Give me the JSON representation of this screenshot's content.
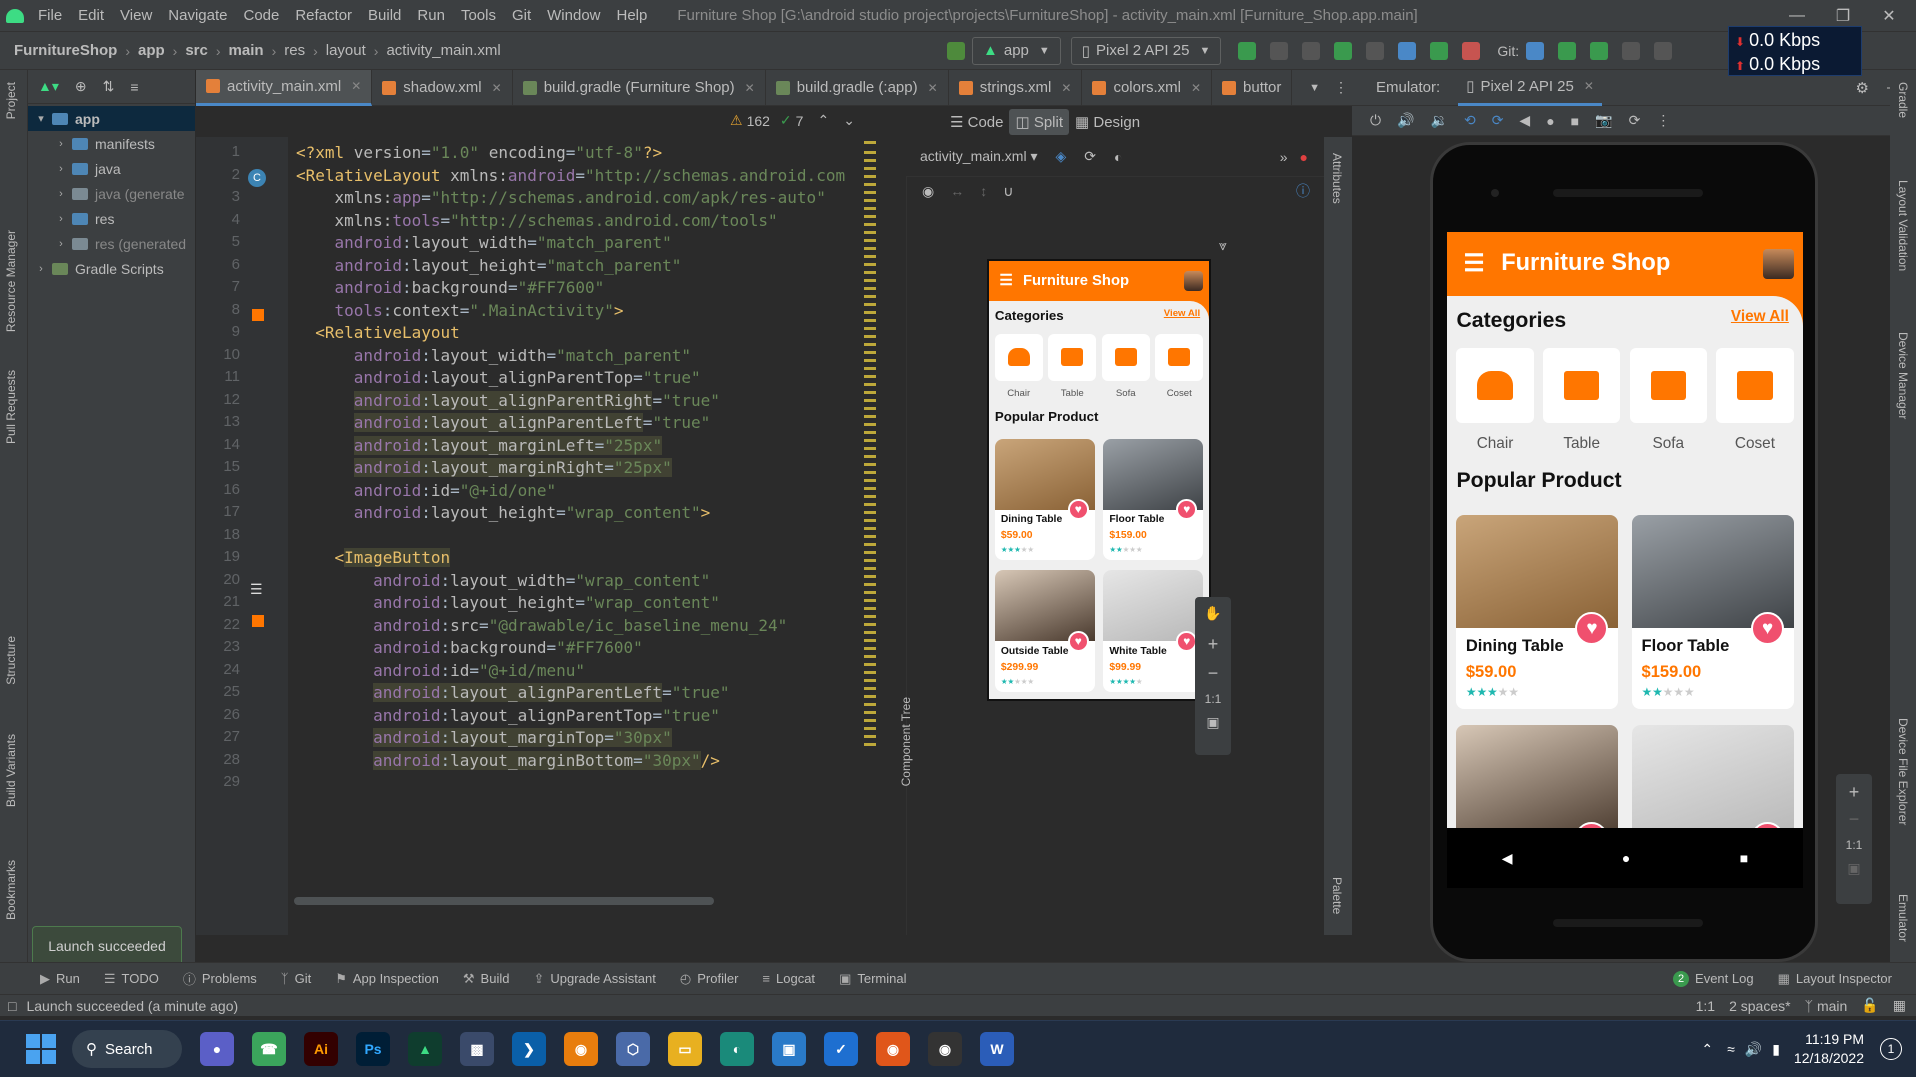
{
  "menubar": {
    "items": [
      "File",
      "Edit",
      "View",
      "Navigate",
      "Code",
      "Refactor",
      "Build",
      "Run",
      "Tools",
      "Git",
      "Window",
      "Help"
    ],
    "window_title": "Furniture Shop [G:\\android studio project\\projects\\FurnitureShop] - activity_main.xml [Furniture_Shop.app.main]"
  },
  "network": {
    "down": "0.0 Kbps",
    "up": "0.0 Kbps"
  },
  "breadcrumb": [
    "FurnitureShop",
    "app",
    "src",
    "main",
    "res",
    "layout",
    "activity_main.xml"
  ],
  "run_config": {
    "module": "app",
    "device": "Pixel 2 API 25",
    "git_label": "Git:"
  },
  "project_panel": {
    "tree": [
      {
        "label": "app",
        "level": 0,
        "expanded": true,
        "selected": true
      },
      {
        "label": "manifests",
        "level": 1
      },
      {
        "label": "java",
        "level": 1
      },
      {
        "label": "java (generate",
        "level": 1
      },
      {
        "label": "res",
        "level": 1
      },
      {
        "label": "res (generated",
        "level": 1
      },
      {
        "label": "Gradle Scripts",
        "level": 0
      }
    ]
  },
  "left_strip": [
    "Project",
    "Resource Manager",
    "Pull Requests",
    "Structure",
    "Build Variants",
    "Bookmarks"
  ],
  "right_strip": [
    "Gradle",
    "Layout Validation",
    "Device Manager",
    "Device File Explorer",
    "Emulator"
  ],
  "editor_tabs": [
    "activity_main.xml",
    "shadow.xml",
    "build.gradle (Furniture Shop)",
    "build.gradle (:app)",
    "strings.xml",
    "colors.xml",
    "buttor"
  ],
  "emulator_header": {
    "label": "Emulator:",
    "device": "Pixel 2 API 25"
  },
  "view_modes": [
    "Code",
    "Split",
    "Design"
  ],
  "inspections": {
    "warnings": "162",
    "weak": "7"
  },
  "design_file": "activity_main.xml",
  "code_lines": [
    {
      "n": "1",
      "html": "<span class='p'>&lt;?xml </span><span class='at'>version</span>=<span class='v'>\"1.0\"</span> <span class='at'>encoding</span>=<span class='v'>\"utf-8\"</span><span class='p'>?&gt;</span>"
    },
    {
      "n": "2",
      "html": "<span class='t'>&lt;RelativeLayout </span><span class='at'>xmlns:</span><span class='ns'>android</span>=<span class='v'>\"http://schemas.android.com</span>"
    },
    {
      "n": "3",
      "html": "    <span class='at'>xmlns:</span><span class='ns'>app</span>=<span class='v'>\"http://schemas.android.com/apk/res-auto\"</span>"
    },
    {
      "n": "4",
      "html": "    <span class='at'>xmlns:</span><span class='ns'>tools</span>=<span class='v'>\"http://schemas.android.com/tools\"</span>"
    },
    {
      "n": "5",
      "html": "    <span class='ns'>android</span>:<span class='at'>layout_width</span>=<span class='v'>\"match_parent\"</span>"
    },
    {
      "n": "6",
      "html": "    <span class='ns'>android</span>:<span class='at'>layout_height</span>=<span class='v'>\"match_parent\"</span>"
    },
    {
      "n": "7",
      "html": "    <span class='ns'>android</span>:<span class='at'>background</span>=<span class='v'>\"#FF7600\"</span>"
    },
    {
      "n": "8",
      "html": "    <span class='ns'>tools</span>:<span class='at'>context</span>=<span class='v'>\".MainActivity\"</span><span class='t'>&gt;</span>"
    },
    {
      "n": "9",
      "html": "  <span class='t'>&lt;RelativeLayout</span>"
    },
    {
      "n": "10",
      "html": "      <span class='ns'>android</span>:<span class='at'>layout_width</span>=<span class='v'>\"match_parent\"</span>"
    },
    {
      "n": "11",
      "html": "      <span class='ns'>android</span>:<span class='at'>layout_alignParentTop</span>=<span class='v'>\"true\"</span>"
    },
    {
      "n": "12",
      "html": "      <span class='hl'><span class='ns'>android</span>:<span class='at'>layout_alignParentRight</span></span>=<span class='v'>\"true\"</span>"
    },
    {
      "n": "13",
      "html": "      <span class='hl'><span class='ns'>android</span>:<span class='at'>layout_alignParentLeft</span></span>=<span class='v'>\"true\"</span>"
    },
    {
      "n": "14",
      "html": "      <span class='hl'><span class='ns'>android</span>:<span class='at'>layout_marginLeft</span>=<span class='v'>\"25px\"</span></span>"
    },
    {
      "n": "15",
      "html": "      <span class='hl'><span class='ns'>android</span>:<span class='at'>layout_marginRight</span>=<span class='v'>\"25px\"</span></span>"
    },
    {
      "n": "16",
      "html": "      <span class='ns'>android</span>:<span class='at'>id</span>=<span class='v'>\"@+id/one\"</span>"
    },
    {
      "n": "17",
      "html": "      <span class='ns'>android</span>:<span class='at'>layout_height</span>=<span class='v'>\"wrap_content\"</span><span class='t'>&gt;</span>"
    },
    {
      "n": "18",
      "html": ""
    },
    {
      "n": "19",
      "html": "    <span class='t'>&lt;</span><span class='hl t'>ImageButton</span>"
    },
    {
      "n": "20",
      "html": "        <span class='ns'>android</span>:<span class='at'>layout_width</span>=<span class='v'>\"wrap_content\"</span>"
    },
    {
      "n": "21",
      "html": "        <span class='ns'>android</span>:<span class='at'>layout_height</span>=<span class='v'>\"wrap_content\"</span>"
    },
    {
      "n": "22",
      "html": "        <span class='ns'>android</span>:<span class='at'>src</span>=<span class='v'>\"@drawable/ic_baseline_menu_24\"</span>"
    },
    {
      "n": "23",
      "html": "        <span class='ns'>android</span>:<span class='at'>background</span>=<span class='v'>\"#FF7600\"</span>"
    },
    {
      "n": "24",
      "html": "        <span class='ns'>android</span>:<span class='at'>id</span>=<span class='v'>\"@+id/menu\"</span>"
    },
    {
      "n": "25",
      "html": "        <span class='hl'><span class='ns'>android</span>:<span class='at'>layout_alignParentLeft</span></span>=<span class='v'>\"true\"</span>"
    },
    {
      "n": "26",
      "html": "        <span class='ns'>android</span>:<span class='at'>layout_alignParentTop</span>=<span class='v'>\"true\"</span>"
    },
    {
      "n": "27",
      "html": "        <span class='hl'><span class='ns'>android</span>:<span class='at'>layout_marginTop</span>=<span class='v'>\"30px\"</span></span>"
    },
    {
      "n": "28",
      "html": "        <span class='hl'><span class='ns'>android</span>:<span class='at'>layout_marginBottom</span>=<span class='v'>\"30px\"</span></span><span class='t'>/&gt;</span>"
    },
    {
      "n": "29",
      "html": ""
    }
  ],
  "app": {
    "title": "Furniture Shop",
    "categories_title": "Categories",
    "view_all": "View All",
    "categories": [
      "Chair",
      "Table",
      "Sofa",
      "Coset"
    ],
    "popular_title": "Popular Product",
    "products": [
      {
        "name": "Dining Table",
        "price": "$59.00",
        "stars": 3
      },
      {
        "name": "Floor Table",
        "price": "$159.00",
        "stars": 1.5
      },
      {
        "name": "Outside Table",
        "price": "$299.99",
        "stars": 1.5
      },
      {
        "name": "White Table",
        "price": "$99.99",
        "stars": 4
      }
    ]
  },
  "side_strips": {
    "component_tree": "Component Tree",
    "attributes": "Attributes",
    "palette": "Palette"
  },
  "zoom_label": "1:1",
  "bottom_tools": [
    "Run",
    "TODO",
    "Problems",
    "Git",
    "App Inspection",
    "Build",
    "Upgrade Assistant",
    "Profiler",
    "Logcat",
    "Terminal"
  ],
  "bottom_right_tools": [
    "Event Log",
    "Layout Inspector"
  ],
  "event_count": "2",
  "toast": "Launch succeeded",
  "status": {
    "message": "Launch succeeded (a minute ago)",
    "position": "1:1",
    "indent": "2 spaces*",
    "branch": "main"
  },
  "taskbar": {
    "search": "Search",
    "time": "11:19 PM",
    "date": "12/18/2022",
    "notifications": "1"
  },
  "colors": {
    "accent": "#ff7600",
    "heart": "#f0506e",
    "star": "#1fb8b0",
    "ide_bg": "#2b2b2b",
    "panel": "#3c3f41"
  }
}
